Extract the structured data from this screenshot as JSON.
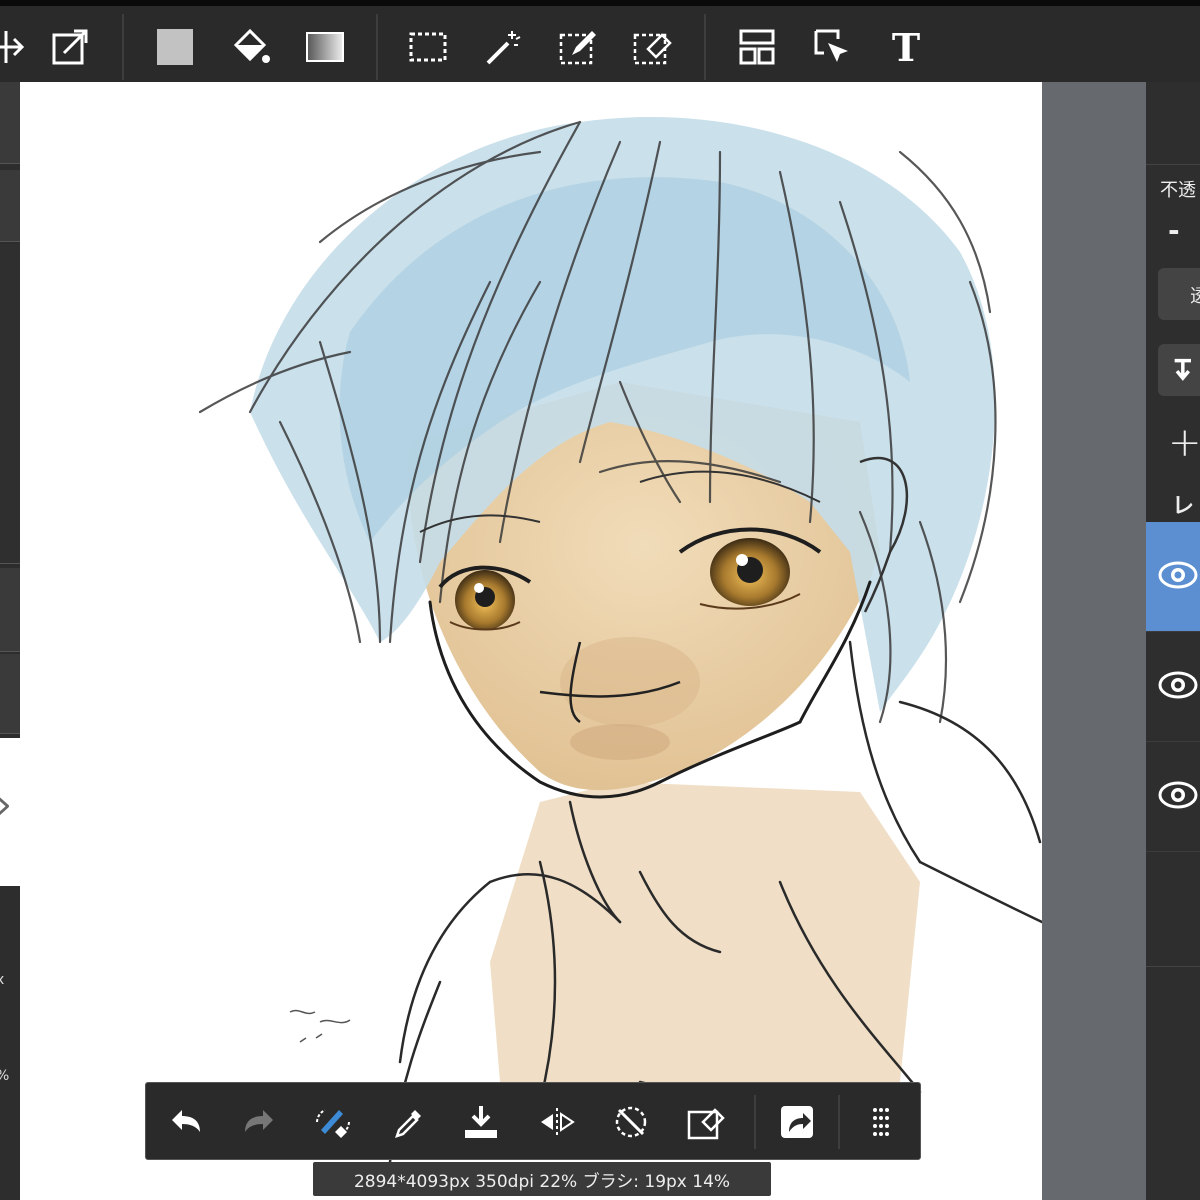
{
  "toolbar": {
    "items": [
      "transform-tool",
      "export-tool",
      "fill-color-swatch",
      "bucket-tool",
      "gradient-tool",
      "rect-select-tool",
      "magic-wand-tool",
      "select-pen-tool",
      "select-eraser-tool",
      "layout-tool",
      "object-select-tool",
      "text-tool"
    ],
    "text_tool_glyph": "T"
  },
  "colors": {
    "hair": "#c4dde9",
    "skin": "#e8cfa6",
    "iris": "#a87a2e",
    "active_layer": "#5b8fd2"
  },
  "left_panel": {
    "arrow_glyph": "›",
    "label_x": "x",
    "label_pct": "%"
  },
  "right_panel": {
    "opacity_label": "不透",
    "minus": "-",
    "button_label": "透",
    "plus": "+",
    "layer_label": "レ",
    "layers": [
      {
        "visible": true,
        "active": true
      },
      {
        "visible": true,
        "active": false
      },
      {
        "visible": true,
        "active": false
      }
    ]
  },
  "bottom_toolbar": {
    "items": [
      "undo",
      "redo",
      "brush-eraser-toggle",
      "eyedropper",
      "fill-down",
      "flip-horizontal",
      "rotate-reset",
      "clear-layer",
      "share",
      "more-menu"
    ]
  },
  "status": {
    "text": "2894*4093px 350dpi 22% ブラシ: 19px 14%"
  }
}
